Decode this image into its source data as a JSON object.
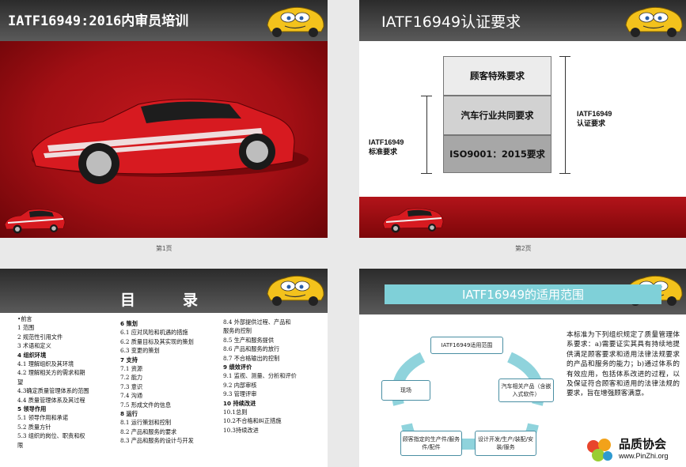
{
  "slides": [
    {
      "title": "IATF16949:2016内审员培训",
      "page_label": "第1页"
    },
    {
      "title": "IATF16949认证要求",
      "page_label": "第2页",
      "stack": [
        "顾客特殊要求",
        "汽车行业共同要求",
        "ISO9001：2015要求"
      ],
      "left_label": [
        "IATF16949",
        "标准要求"
      ],
      "right_label": [
        "IATF16949",
        "认证要求"
      ]
    },
    {
      "title": "目录",
      "col1": [
        {
          "text": "•前言",
          "bold": false
        },
        {
          "text": "1 范围",
          "bold": false
        },
        {
          "text": "2 规范性引用文件",
          "bold": false
        },
        {
          "text": "3 术语和定义",
          "bold": false
        },
        {
          "text": "4 组织环境",
          "bold": true
        },
        {
          "text": "4.1 理解组织及其环境",
          "bold": false
        },
        {
          "text": "4.2 理解相关方的需求和期",
          "bold": false
        },
        {
          "text": "望",
          "bold": false
        },
        {
          "text": "4.3确定质量管理体系的范围",
          "bold": false
        },
        {
          "text": "4.4 质量管理体系及其过程",
          "bold": false
        },
        {
          "text": "5 领导作用",
          "bold": true
        },
        {
          "text": "5.1 领导作用和承诺",
          "bold": false
        },
        {
          "text": "5.2 质量方针",
          "bold": false
        },
        {
          "text": "5.3 组织的岗位、职责和权",
          "bold": false
        },
        {
          "text": "限",
          "bold": false
        }
      ],
      "col2": [
        {
          "text": "6 策划",
          "bold": true
        },
        {
          "text": "6.1 应对风险和机遇的措施",
          "bold": false
        },
        {
          "text": "6.2 质量目标及其实现的策划",
          "bold": false
        },
        {
          "text": "6.3 变更的策划",
          "bold": false
        },
        {
          "text": "7 支持",
          "bold": true
        },
        {
          "text": "7.1 资源",
          "bold": false
        },
        {
          "text": "7.2 能力",
          "bold": false
        },
        {
          "text": "7.3 意识",
          "bold": false
        },
        {
          "text": "7.4 沟通",
          "bold": false
        },
        {
          "text": "7.5 形成文件的信息",
          "bold": false
        },
        {
          "text": "8 运行",
          "bold": true
        },
        {
          "text": "8.1 运行策划和控制",
          "bold": false
        },
        {
          "text": "8.2 产品和服务的要求",
          "bold": false
        },
        {
          "text": "8.3 产品和服务的设计与开发",
          "bold": false
        }
      ],
      "col3": [
        {
          "text": "8.4 外部提供过程、产品和",
          "bold": false
        },
        {
          "text": "服务的控制",
          "bold": false
        },
        {
          "text": "8.5 生产和服务提供",
          "bold": false
        },
        {
          "text": "8.6 产品和服务的放行",
          "bold": false
        },
        {
          "text": "8.7 不合格输出的控制",
          "bold": false
        },
        {
          "text": "9 绩效评价",
          "bold": true
        },
        {
          "text": "9.1 监视、测量、分析和评价",
          "bold": false
        },
        {
          "text": "9.2 内部审核",
          "bold": false
        },
        {
          "text": "9.3 管理评审",
          "bold": false
        },
        {
          "text": "10 持续改进",
          "bold": true
        },
        {
          "text": "10.1总则",
          "bold": false
        },
        {
          "text": "10.2不合格和纠正措施",
          "bold": false
        },
        {
          "text": "10.3持续改进",
          "bold": false
        }
      ]
    },
    {
      "title": "IATF16949的适用范围",
      "flow": {
        "top": "IATF16949适用范围",
        "left": "现场",
        "right": "汽车相关产品（含嵌入式软件）",
        "bottom_left": "顾客指定的生产件/服务件/配件",
        "bottom_right": "设计开发/生产/装配/安装/服务"
      },
      "desc": "本标准为下列组织规定了质量管理体系要求：a)需要证实其具有持续地提供满足顾客要求和适用法律法规要求的产品和服务的能力；b)通过体系的有效应用，包括体系改进的过程，以及保证符合顾客和适用的法律法规的要求，旨在增强顾客满意。"
    }
  ],
  "watermark": {
    "name": "品质协会",
    "url": "www.PinZhi.org"
  }
}
